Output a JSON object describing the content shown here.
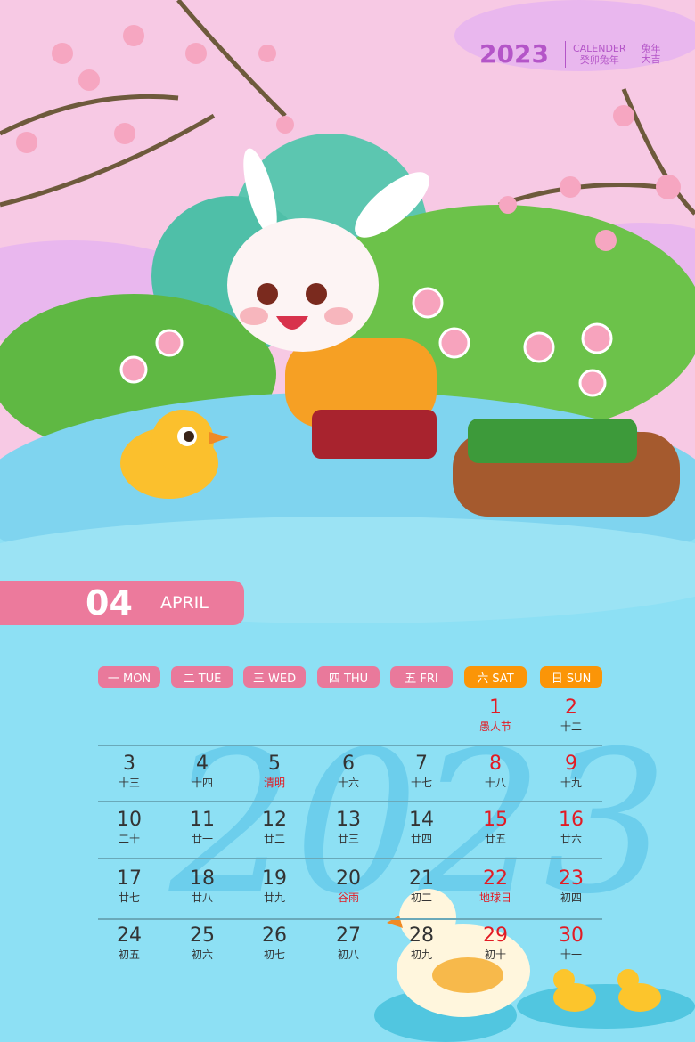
{
  "header": {
    "year": "2023",
    "calendar_label": "CALENDER",
    "subtitle": "癸卯兔年",
    "slogan_line1": "兔年",
    "slogan_line2": "大吉"
  },
  "month": {
    "number": "04",
    "name": "APRIL"
  },
  "weekdays": [
    {
      "label": "一 MON",
      "weekend": false
    },
    {
      "label": "二 TUE",
      "weekend": false
    },
    {
      "label": "三 WED",
      "weekend": false
    },
    {
      "label": "四 THU",
      "weekend": false
    },
    {
      "label": "五 FRI",
      "weekend": false
    },
    {
      "label": "六 SAT",
      "weekend": true
    },
    {
      "label": "日 SUN",
      "weekend": true
    }
  ],
  "colors": {
    "weekday_pill": "#e9799b",
    "weekend_pill": "#fb9507",
    "holiday_red": "#e21b24",
    "sky": "#f7c9e4",
    "water": "#8de0f4",
    "accent_purple": "#b455c8"
  },
  "weeks": [
    [
      null,
      null,
      null,
      null,
      null,
      {
        "day": "1",
        "lunar": "愚人节",
        "festival": true
      },
      {
        "day": "2",
        "lunar": "十二"
      }
    ],
    [
      {
        "day": "3",
        "lunar": "十三"
      },
      {
        "day": "4",
        "lunar": "十四"
      },
      {
        "day": "5",
        "lunar": "清明",
        "festival": true
      },
      {
        "day": "6",
        "lunar": "十六"
      },
      {
        "day": "7",
        "lunar": "十七"
      },
      {
        "day": "8",
        "lunar": "十八"
      },
      {
        "day": "9",
        "lunar": "十九"
      }
    ],
    [
      {
        "day": "10",
        "lunar": "二十"
      },
      {
        "day": "11",
        "lunar": "廿一"
      },
      {
        "day": "12",
        "lunar": "廿二"
      },
      {
        "day": "13",
        "lunar": "廿三"
      },
      {
        "day": "14",
        "lunar": "廿四"
      },
      {
        "day": "15",
        "lunar": "廿五"
      },
      {
        "day": "16",
        "lunar": "廿六"
      }
    ],
    [
      {
        "day": "17",
        "lunar": "廿七"
      },
      {
        "day": "18",
        "lunar": "廿八"
      },
      {
        "day": "19",
        "lunar": "廿九"
      },
      {
        "day": "20",
        "lunar": "谷雨",
        "festival": true
      },
      {
        "day": "21",
        "lunar": "初二"
      },
      {
        "day": "22",
        "lunar": "地球日",
        "festival": true
      },
      {
        "day": "23",
        "lunar": "初四"
      }
    ],
    [
      {
        "day": "24",
        "lunar": "初五"
      },
      {
        "day": "25",
        "lunar": "初六"
      },
      {
        "day": "26",
        "lunar": "初七"
      },
      {
        "day": "27",
        "lunar": "初八"
      },
      {
        "day": "28",
        "lunar": "初九"
      },
      {
        "day": "29",
        "lunar": "初十"
      },
      {
        "day": "30",
        "lunar": "十一"
      }
    ]
  ]
}
